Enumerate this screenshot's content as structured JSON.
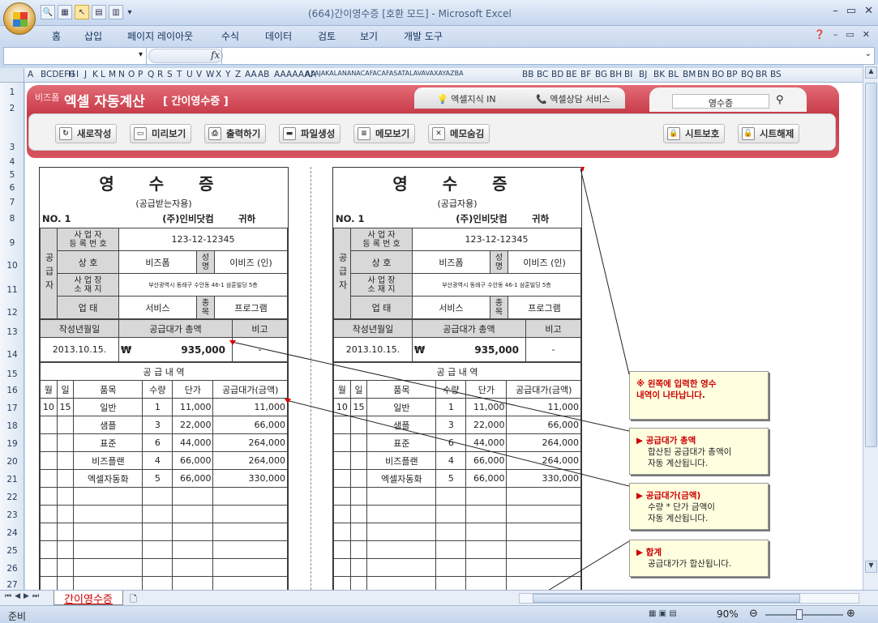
{
  "window": {
    "title": "(664)간이영수증  [호환 모드] - Microsoft Excel"
  },
  "ribbon": {
    "tabs": [
      "홈",
      "삽입",
      "페이지 레이아웃",
      "수식",
      "데이터",
      "검토",
      "보기",
      "개발 도구"
    ]
  },
  "formula": {
    "fx": "fx"
  },
  "columns": [
    "A",
    "BCDEFG",
    "H",
    "I",
    "J",
    "K",
    "L",
    "M",
    "N",
    "O",
    "P",
    "Q",
    "R",
    "S",
    "T",
    "U",
    "V",
    "W",
    "X",
    "Y",
    "Z",
    "AA",
    "AB",
    "AAAAAAA",
    "AI",
    "AJAKALANANACAFACAFASATALAVAVAXAYAZBA",
    "BB",
    "BC",
    "BD",
    "BE",
    "BF",
    "BG",
    "BH",
    "BI",
    "BJ",
    "BK",
    "BL",
    "BM",
    "BN",
    "BO",
    "BP",
    "BQ",
    "BR",
    "BS"
  ],
  "rows": [
    "1",
    "2",
    "3",
    "4",
    "5",
    "6",
    "7",
    "8",
    "9",
    "10",
    "11",
    "12",
    "13",
    "14",
    "15",
    "16",
    "17",
    "18",
    "19",
    "20",
    "21",
    "22",
    "23",
    "24",
    "25",
    "26",
    "27"
  ],
  "app": {
    "brand": "비즈폼",
    "title": "엑셀 자동계산",
    "subtitle": "[ 간이영수증 ]",
    "toptab1": "엑셀지식 IN",
    "toptab2": "엑셀상담 서비스",
    "search": "영수증",
    "buttons": [
      "새로작성",
      "미리보기",
      "출력하기",
      "파일생성",
      "메모보기",
      "메모숨김"
    ],
    "right_buttons": [
      "시트보호",
      "시트해제"
    ]
  },
  "left": {
    "title": "영 수 증",
    "sub": "(공급받는자용)"
  },
  "right": {
    "title": "영 수 증",
    "sub": "(공급자용)"
  },
  "receipt": {
    "no": "NO. 1",
    "buyer": "(주)인비닷컴",
    "honor": "귀하",
    "side": "공급자",
    "reg_label": "사 업 자\n등 록 번 호",
    "reg": "123-12-12345",
    "name_label": "상       호",
    "name": "비즈폼",
    "rep_label": "성명",
    "rep": "이비즈   (인)",
    "addr_label": "사 업 장\n소 재 지",
    "addr": "부산광역시 동래구 수안동 46-1 삼훈빌딩 5층",
    "biz_label": "업       태",
    "biz": "서비스",
    "item_label": "종목",
    "item": "프로그램",
    "h_date": "작성년월일",
    "h_total": "공급대가 총액",
    "h_note": "비고",
    "date": "2013.10.15.",
    "won": "₩",
    "total": "935,000",
    "note": "-",
    "detail_title": "공   급   내   역",
    "cols": [
      "월",
      "일",
      "품목",
      "수량",
      "단가",
      "공급대가(금액)"
    ],
    "lines": [
      [
        "10",
        "15",
        "일반",
        "1",
        "11,000",
        "11,000"
      ],
      [
        "",
        "",
        "샘플",
        "3",
        "22,000",
        "66,000"
      ],
      [
        "",
        "",
        "표준",
        "6",
        "44,000",
        "264,000"
      ],
      [
        "",
        "",
        "비즈플랜",
        "4",
        "66,000",
        "264,000"
      ],
      [
        "",
        "",
        "엑셀자동화",
        "5",
        "66,000",
        "330,000"
      ]
    ]
  },
  "notes": [
    {
      "h": "※ 왼쪽에 입력한 영수\n   내역이 나타납니다.",
      "b": ""
    },
    {
      "h": "▶ 공급대가 총액",
      "b": "합산된 공급대가 총액이\n자동 계산됩니다."
    },
    {
      "h": "▶ 공급대가(금액)",
      "b": "수량 * 단가 금액이\n자동 계산됩니다."
    },
    {
      "h": "▶ 합계",
      "b": "공급대가가 합산됩니다."
    }
  ],
  "sheet_tab": "간이영수증",
  "status": {
    "ready": "준비",
    "zoom": "90%"
  }
}
